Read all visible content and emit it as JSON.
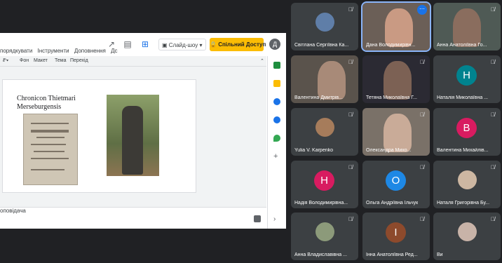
{
  "slides": {
    "menu": [
      "порядкувати",
      "Інструменти",
      "Доповнення",
      "Дс"
    ],
    "toolbar": {
      "slideshow_label": "Слайд-шоу",
      "share_label": "Спільний Доступ",
      "avatar_letter": "Д"
    },
    "format_bar": [
      "Фон",
      "Макет",
      "Тема",
      "Перехід"
    ],
    "slide_title": "Chronicon Thietmari\nMerseburgensis",
    "notes_text": "оповідача"
  },
  "participants": [
    {
      "name": "Світлана Сергіївна Ка...",
      "type": "photo",
      "muted": true
    },
    {
      "name": "Дана Володимирівн...",
      "type": "video",
      "muted": false,
      "active": true
    },
    {
      "name": "Анна Анатоліївна Го...",
      "type": "video",
      "muted": true
    },
    {
      "name": "Валентина Дмитрів...",
      "type": "video",
      "muted": true
    },
    {
      "name": "Тетяна Миколаївна Г...",
      "type": "video",
      "muted": true
    },
    {
      "name": "Наталія Миколаївна ...",
      "type": "letter",
      "letter": "Н",
      "color": "#00838f",
      "muted": true
    },
    {
      "name": "Yulia V. Karpenko",
      "type": "photo",
      "muted": true
    },
    {
      "name": "Олександра Михо...",
      "type": "video",
      "muted": true
    },
    {
      "name": "Валентина Михайлів...",
      "type": "letter",
      "letter": "В",
      "color": "#d81b60",
      "muted": true
    },
    {
      "name": "Надія Володимирівна...",
      "type": "letter",
      "letter": "Н",
      "color": "#d81b60",
      "muted": true
    },
    {
      "name": "Ольга Андріївна Ільчук",
      "type": "letter",
      "letter": "О",
      "color": "#1e88e5",
      "muted": true
    },
    {
      "name": "Наталя Григорівна Бу...",
      "type": "photo",
      "muted": true
    },
    {
      "name": "Анна Владиславівна ...",
      "type": "photo",
      "muted": true
    },
    {
      "name": "Інна Анатоліївна Ред...",
      "type": "letter",
      "letter": "І",
      "color": "#8d4a2c",
      "muted": true
    },
    {
      "name": "Ви",
      "type": "photo",
      "muted": true
    }
  ]
}
